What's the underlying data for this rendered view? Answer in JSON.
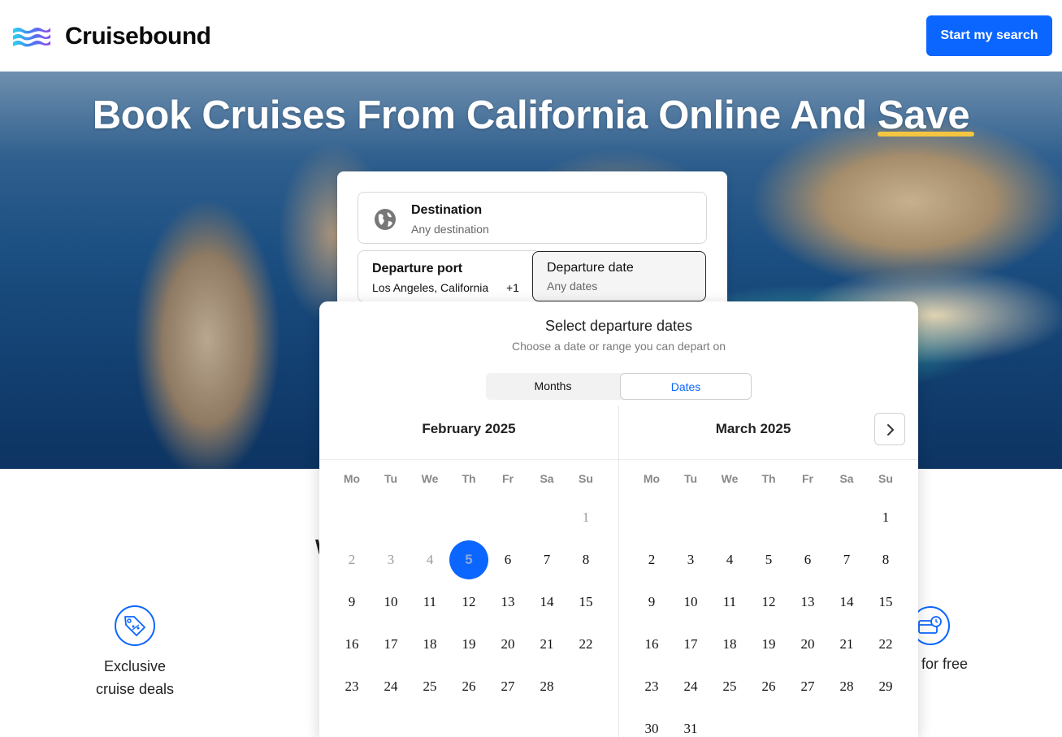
{
  "brand": {
    "name": "Cruisebound"
  },
  "header": {
    "cta_label": "Start my search"
  },
  "hero": {
    "title_main": "Book Cruises From California Online And ",
    "title_highlight": "Save"
  },
  "search": {
    "destination": {
      "label": "Destination",
      "value": "Any destination"
    },
    "departure_port": {
      "label": "Departure port",
      "value": "Los Angeles, California",
      "extra": "+1"
    },
    "departure_date": {
      "label": "Departure date",
      "value": "Any dates"
    }
  },
  "picker": {
    "title": "Select departure dates",
    "subtitle": "Choose a date or range you can depart on",
    "tabs": {
      "months": "Months",
      "dates": "Dates"
    },
    "weekdays": [
      "Mo",
      "Tu",
      "We",
      "Th",
      "Fr",
      "Sa",
      "Su"
    ],
    "months": [
      {
        "name": "February 2025",
        "weeks": [
          [
            "",
            "",
            "",
            "",
            "",
            "",
            "1"
          ],
          [
            "2",
            "3",
            "4",
            "5",
            "6",
            "7",
            "8"
          ],
          [
            "9",
            "10",
            "11",
            "12",
            "13",
            "14",
            "15"
          ],
          [
            "16",
            "17",
            "18",
            "19",
            "20",
            "21",
            "22"
          ],
          [
            "23",
            "24",
            "25",
            "26",
            "27",
            "28",
            ""
          ]
        ],
        "selected": "5",
        "past": [
          "1",
          "2",
          "3",
          "4"
        ]
      },
      {
        "name": "March 2025",
        "weeks": [
          [
            "",
            "",
            "",
            "",
            "",
            "",
            "1"
          ],
          [
            "2",
            "3",
            "4",
            "5",
            "6",
            "7",
            "8"
          ],
          [
            "9",
            "10",
            "11",
            "12",
            "13",
            "14",
            "15"
          ],
          [
            "16",
            "17",
            "18",
            "19",
            "20",
            "21",
            "22"
          ],
          [
            "23",
            "24",
            "25",
            "26",
            "27",
            "28",
            "29"
          ],
          [
            "30",
            "31",
            "",
            "",
            "",
            "",
            ""
          ]
        ]
      }
    ]
  },
  "features": {
    "left": {
      "line1": "Exclusive",
      "line2": "cruise deals"
    },
    "right": {
      "text": "for free"
    },
    "partial_heading": "W"
  },
  "colors": {
    "accent": "#0b66ff",
    "highlight": "#f5c542"
  }
}
